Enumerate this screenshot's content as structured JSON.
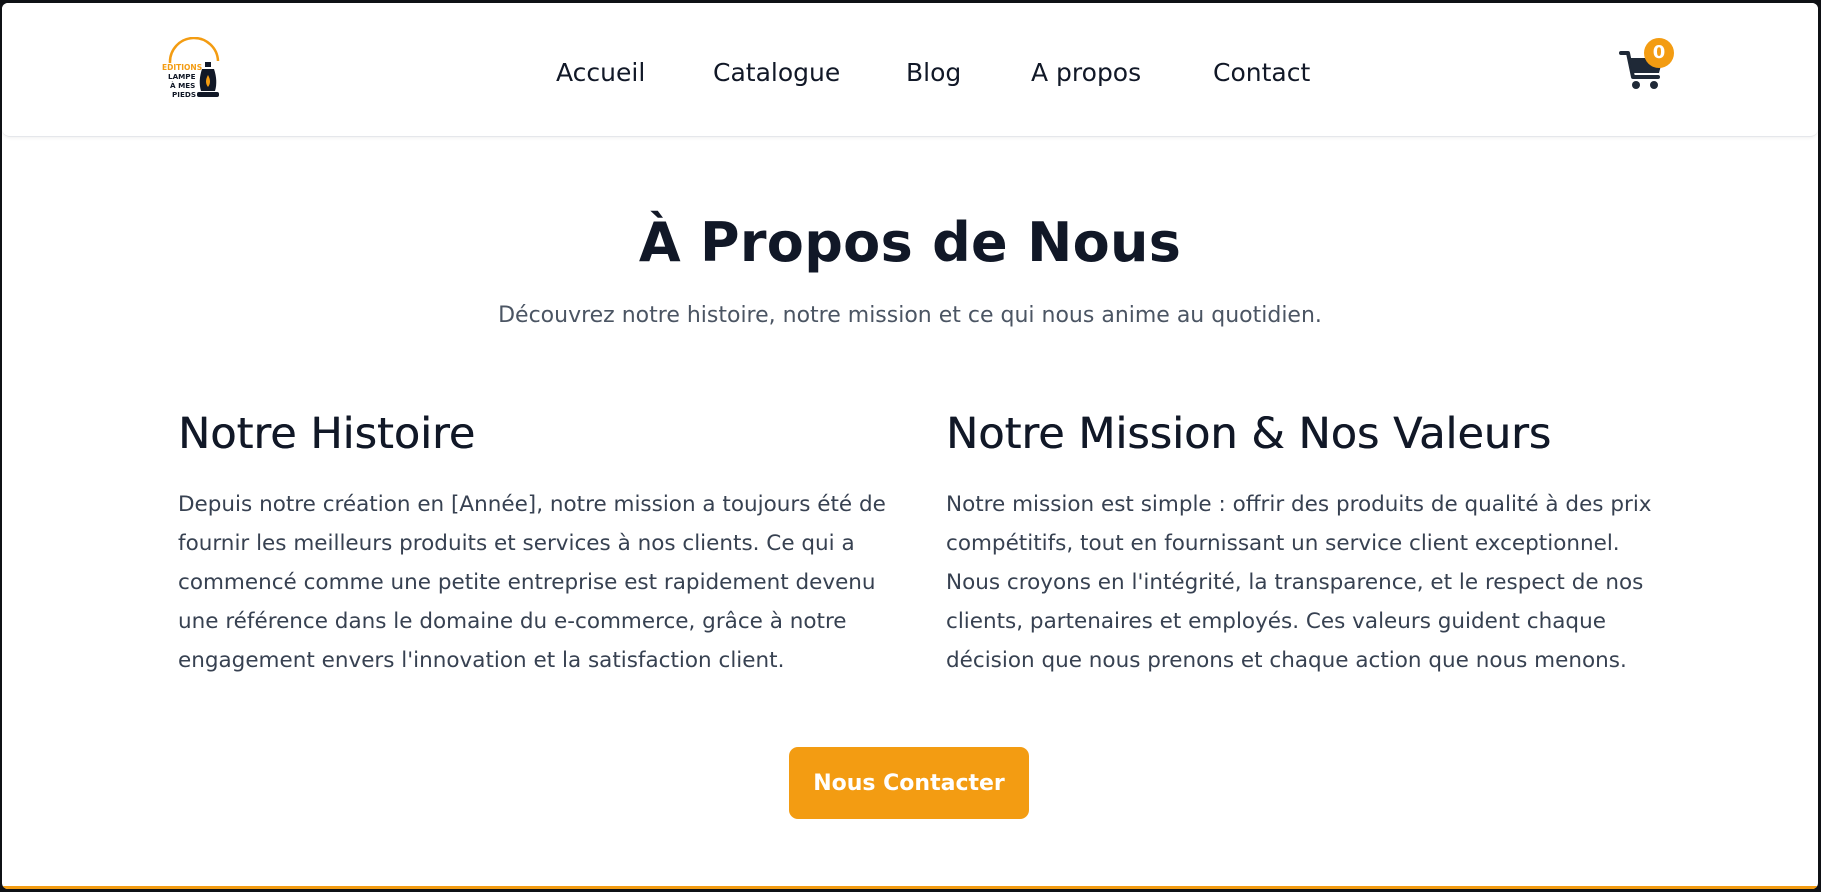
{
  "colors": {
    "accent": "#f39c12",
    "text_dark": "#111827",
    "text_muted": "#4b5563",
    "background": "#ffffff"
  },
  "header": {
    "logo": {
      "icon": "lamp-icon",
      "lines": [
        "EDITIONS",
        "LAMPE",
        "À MES",
        "PIEDS"
      ]
    },
    "nav": [
      {
        "label": "Accueil"
      },
      {
        "label": "Catalogue"
      },
      {
        "label": "Blog"
      },
      {
        "label": "A propos"
      },
      {
        "label": "Contact"
      }
    ],
    "cart": {
      "icon": "shopping-cart-icon",
      "count": "0"
    }
  },
  "main": {
    "title": "À Propos de Nous",
    "subtitle": "Découvrez notre histoire, notre mission et ce qui nous anime au quotidien.",
    "sections": [
      {
        "heading": "Notre Histoire",
        "body": "Depuis notre création en [Année], notre mission a toujours été de fournir les meilleurs produits et services à nos clients. Ce qui a commencé comme une petite entreprise est rapidement devenu une référence dans le domaine du e-commerce, grâce à notre engagement envers l'innovation et la satisfaction client."
      },
      {
        "heading": "Notre Mission & Nos Valeurs",
        "body": "Notre mission est simple : offrir des produits de qualité à des prix compétitifs, tout en fournissant un service client exceptionnel. Nous croyons en l'intégrité, la transparence, et le respect de nos clients, partenaires et employés. Ces valeurs guident chaque décision que nous prenons et chaque action que nous menons."
      }
    ],
    "cta_label": "Nous Contacter"
  }
}
